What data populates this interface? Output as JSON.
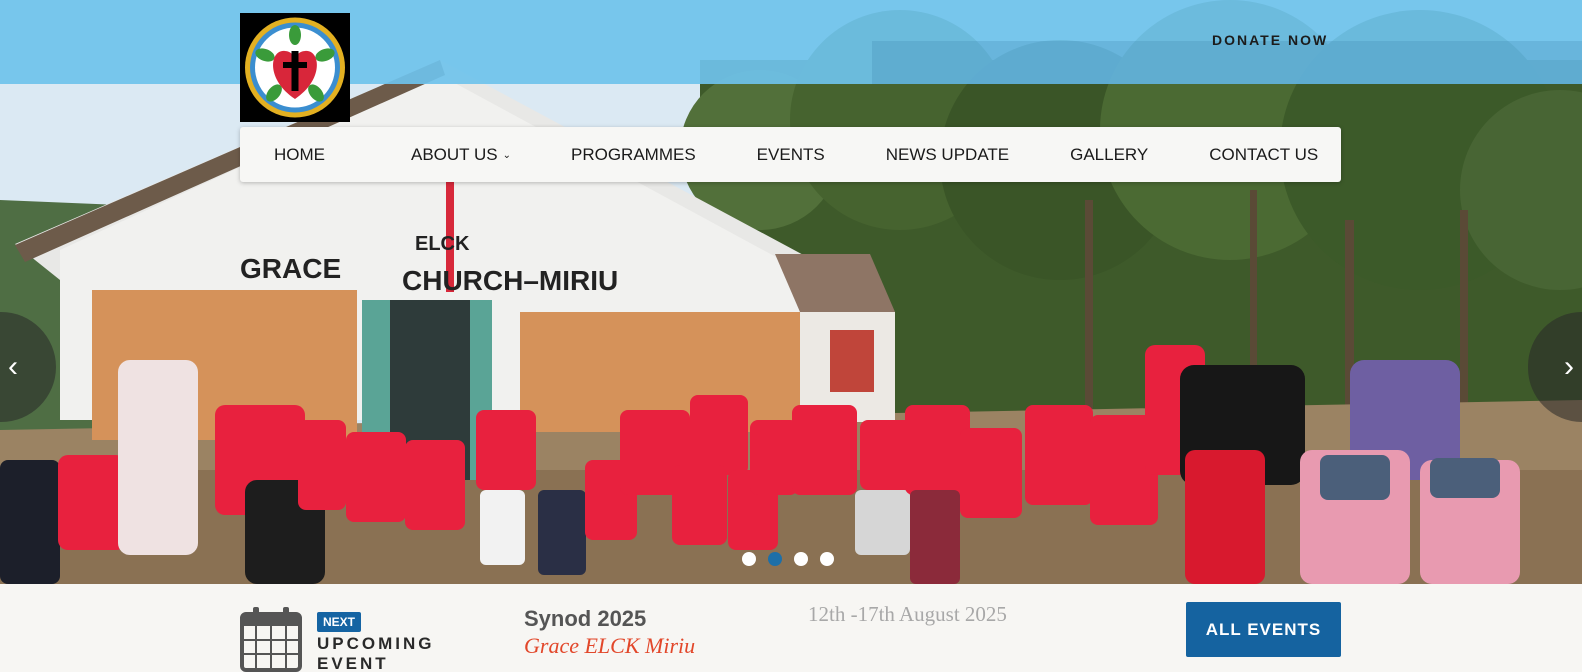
{
  "header": {
    "logo_icon": "luther-rose-icon",
    "donate_label": "DONATE NOW"
  },
  "nav": {
    "items": [
      {
        "label": "HOME"
      },
      {
        "label": "ABOUT US",
        "has_dropdown": true
      },
      {
        "label": "PROGRAMMES"
      },
      {
        "label": "EVENTS"
      },
      {
        "label": "NEWS UPDATE"
      },
      {
        "label": "GALLERY"
      },
      {
        "label": "CONTACT US"
      }
    ]
  },
  "hero": {
    "church_sign_line1": "ELCK",
    "church_sign_line2": "GRACE",
    "church_sign_line3": "CHURCH–MIRIU",
    "prev_label": "‹",
    "next_label": "›",
    "slide_count": 4,
    "active_slide_index": 1
  },
  "event": {
    "badge": "NEXT",
    "kind_label": "UPCOMING EVENT",
    "title": "Synod 2025",
    "venue": "Grace ELCK Miriu",
    "date": "12th -17th August 2025",
    "all_events_label": "ALL EVENTS"
  },
  "colors": {
    "topbar": "#6fc2ec",
    "accent_blue": "#1563a0",
    "venue_red": "#e2472a",
    "shirt_red": "#e8213e"
  }
}
